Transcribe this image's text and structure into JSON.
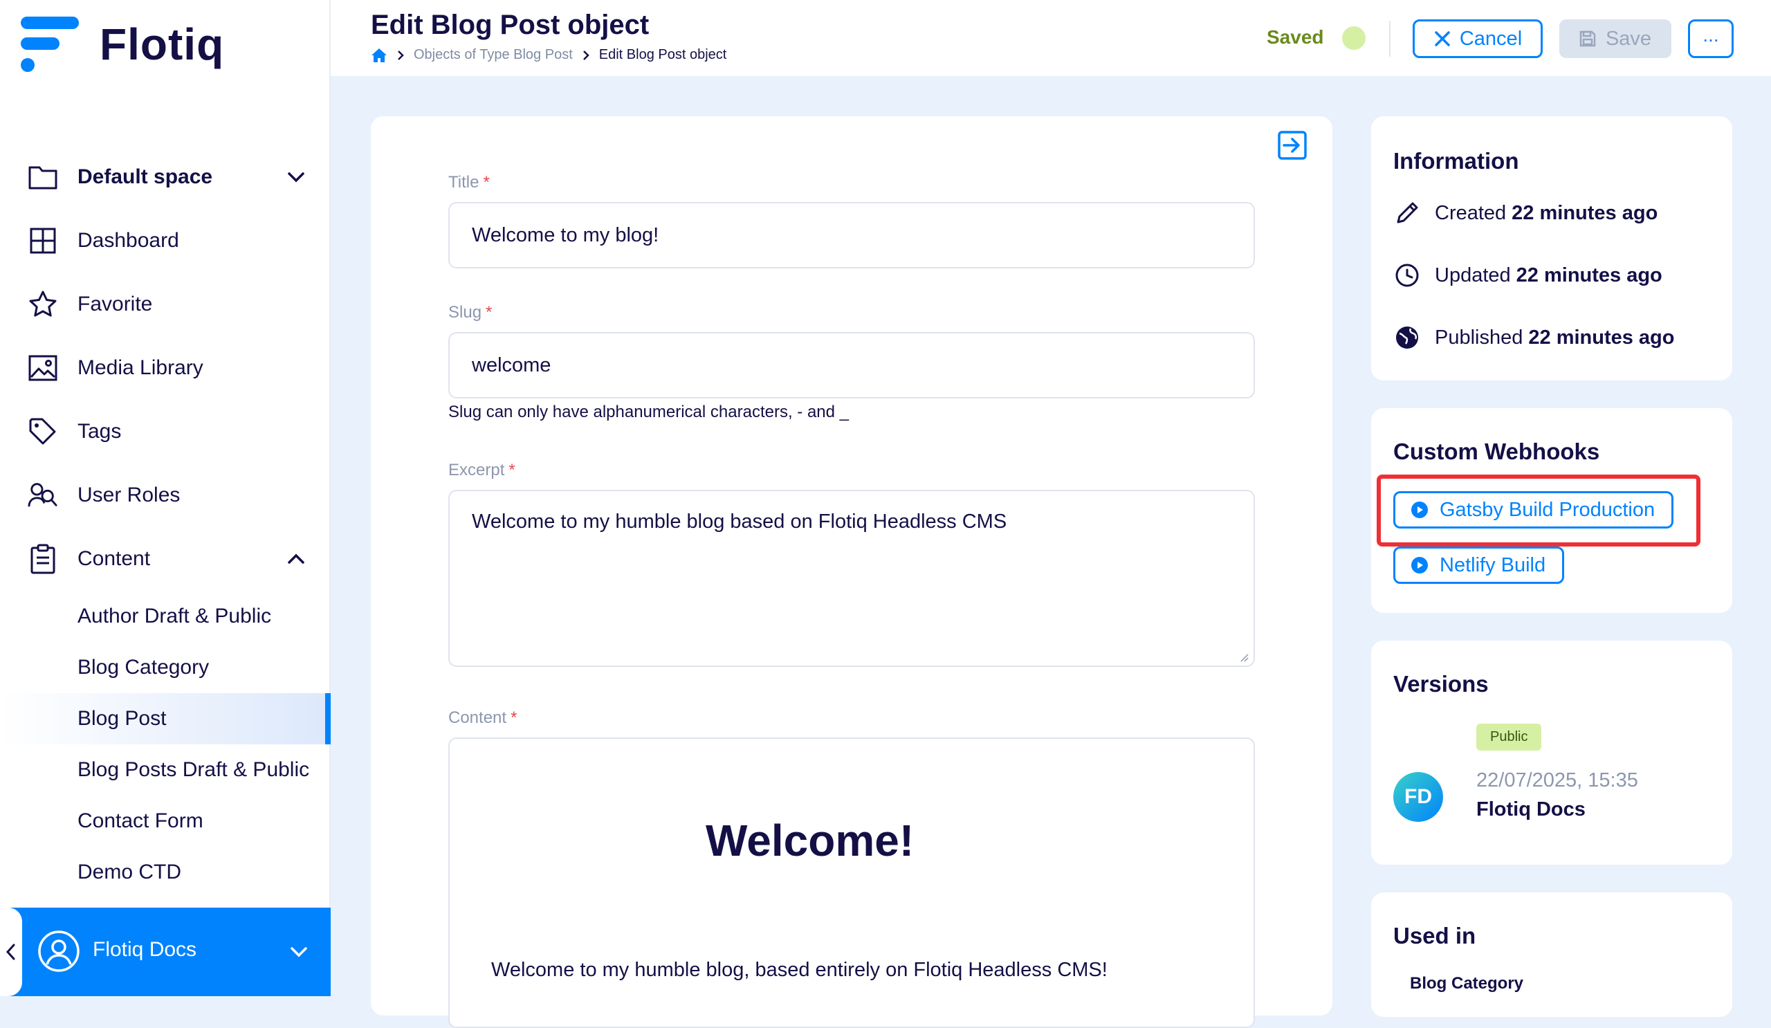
{
  "app": {
    "name": "Flotiq"
  },
  "sidebar": {
    "space": "Default space",
    "items": [
      {
        "label": "Dashboard"
      },
      {
        "label": "Favorite"
      },
      {
        "label": "Media Library"
      },
      {
        "label": "Tags"
      },
      {
        "label": "User Roles"
      }
    ],
    "content_label": "Content",
    "content_items": [
      "Author Draft & Public",
      "Blog Category",
      "Blog Post",
      "Blog Posts Draft & Public",
      "Contact Form",
      "Demo CTD"
    ],
    "active_item": "Blog Post",
    "user": "Flotiq Docs"
  },
  "header": {
    "title": "Edit Blog Post object",
    "breadcrumb": [
      "Objects of Type Blog Post",
      "Edit Blog Post object"
    ],
    "status": "Saved",
    "cancel_label": "Cancel",
    "save_label": "Save",
    "more_label": "..."
  },
  "form": {
    "title_label": "Title",
    "title_value": "Welcome to my blog!",
    "slug_label": "Slug",
    "slug_value": "welcome",
    "slug_hint": "Slug can only have alphanumerical characters, - and _",
    "excerpt_label": "Excerpt",
    "excerpt_value": "Welcome to my humble blog based on Flotiq Headless CMS",
    "content_label": "Content",
    "content_heading": "Welcome!",
    "content_paragraph": "Welcome to my humble blog, based entirely on Flotiq Headless CMS!",
    "required_mark": "*"
  },
  "information": {
    "title": "Information",
    "created_label": "Created",
    "created_value": "22 minutes ago",
    "updated_label": "Updated",
    "updated_value": "22 minutes ago",
    "published_label": "Published",
    "published_value": "22 minutes ago"
  },
  "webhooks": {
    "title": "Custom Webhooks",
    "items": [
      "Gatsby Build Production",
      "Netlify Build"
    ]
  },
  "versions": {
    "title": "Versions",
    "badge": "Public",
    "avatar_initials": "FD",
    "date": "22/07/2025, 15:35",
    "author": "Flotiq Docs"
  },
  "used_in": {
    "title": "Used in",
    "items": [
      "Blog Category"
    ]
  },
  "colors": {
    "accent": "#0083fc",
    "navy": "#141046",
    "highlight": "#ef2f35",
    "saved_green": "#d5f0a2"
  }
}
